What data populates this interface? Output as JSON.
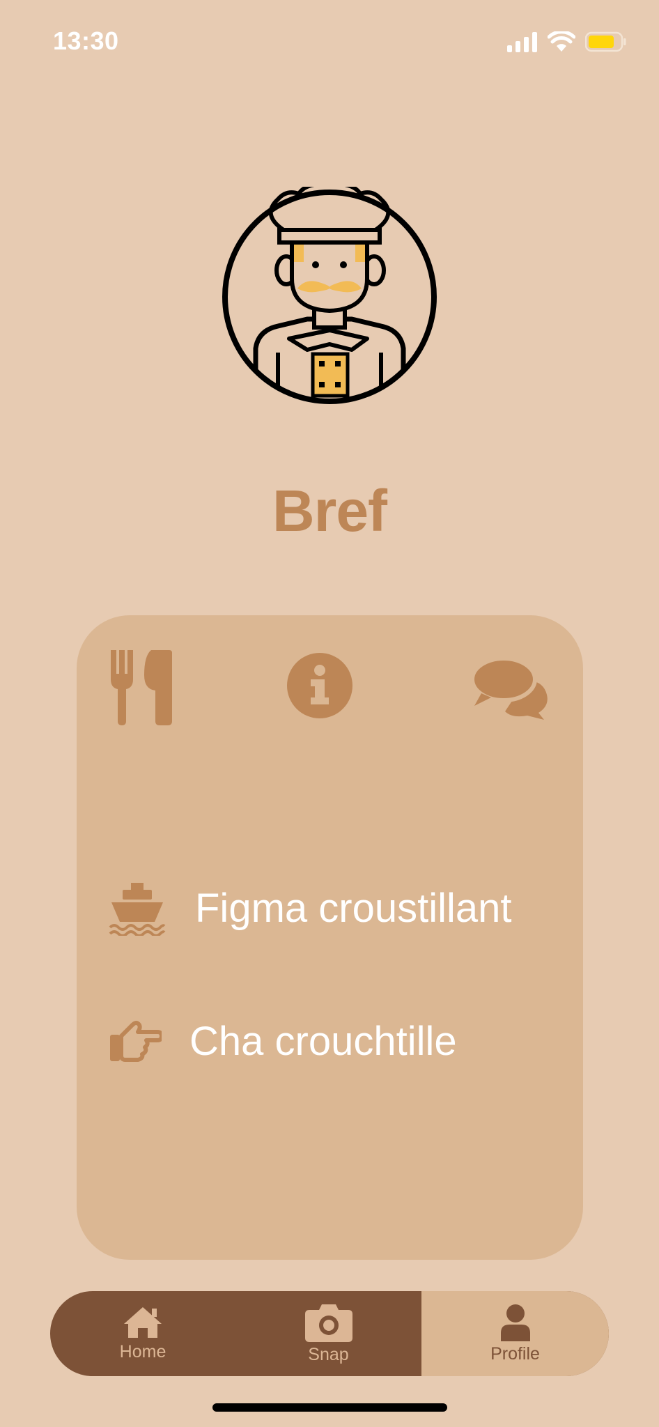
{
  "status_bar": {
    "time": "13:30",
    "battery_color": "#ffd60a"
  },
  "profile": {
    "name": "Bref",
    "avatar_icon": "chef-avatar-icon"
  },
  "card": {
    "tabs": [
      {
        "icon": "fork-knife-icon"
      },
      {
        "icon": "info-icon"
      },
      {
        "icon": "comments-icon"
      }
    ],
    "items": [
      {
        "icon": "ship-icon",
        "label": "Figma croustillant"
      },
      {
        "icon": "hand-point-right-icon",
        "label": "Cha crouchtille"
      }
    ]
  },
  "nav": {
    "items": [
      {
        "label": "Home",
        "icon": "home-icon"
      },
      {
        "label": "Snap",
        "icon": "camera-icon"
      },
      {
        "label": "Profile",
        "icon": "user-icon"
      }
    ],
    "active": "Profile"
  },
  "colors": {
    "background": "#e7cbb2",
    "accent": "#bd8656",
    "card": "#dbb793",
    "nav_dark": "#7d5237"
  }
}
